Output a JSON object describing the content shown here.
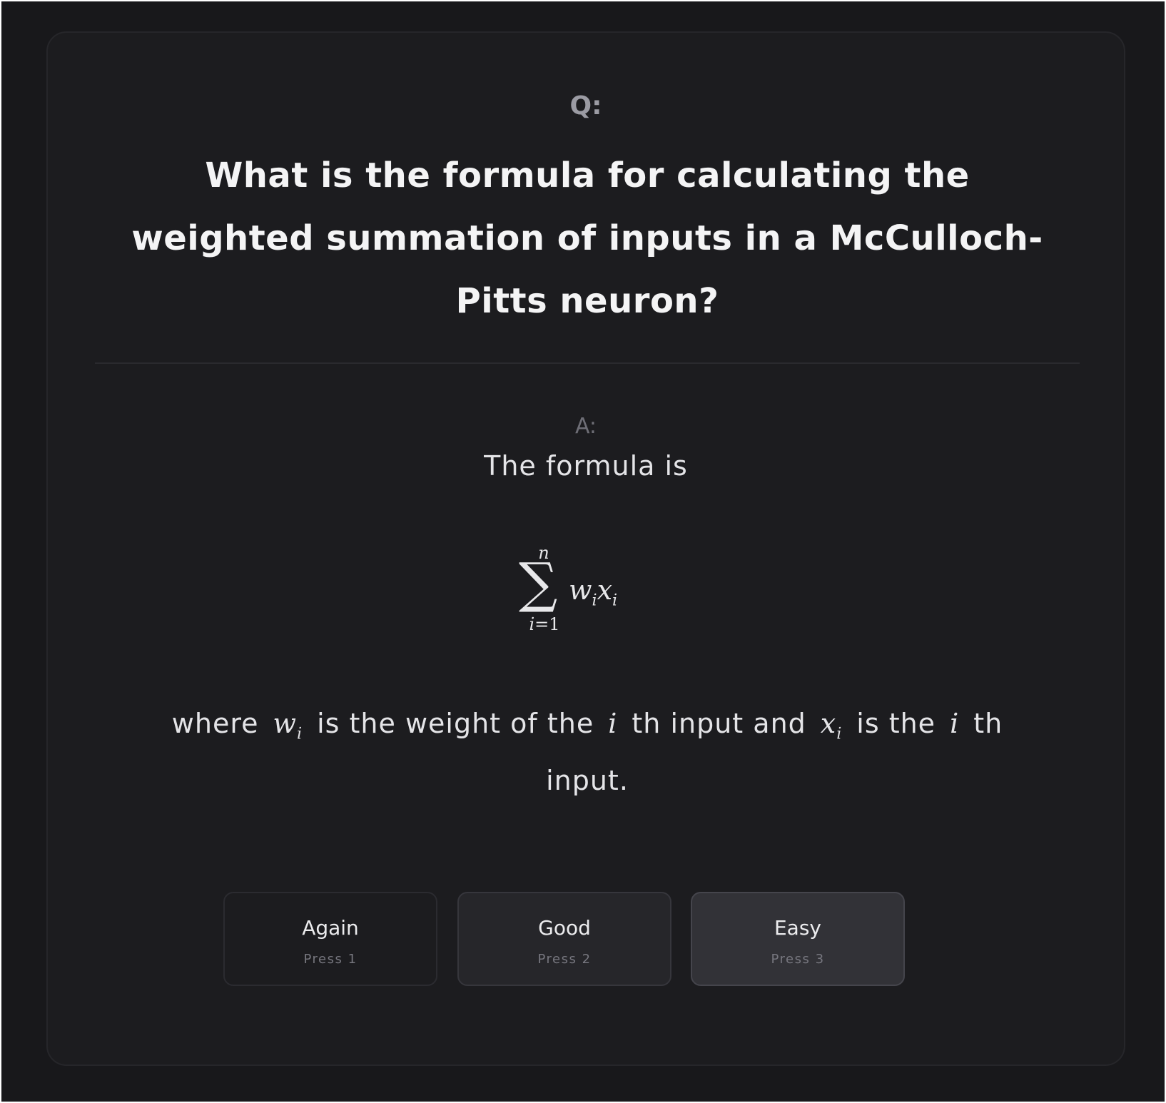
{
  "question": {
    "label": "Q:",
    "text": "What is the formula for calculating the weighted summation of inputs in a McCulloch-Pitts neuron?"
  },
  "answer": {
    "label": "A:",
    "intro": "The formula is",
    "formula": {
      "operator": "∑",
      "upper_limit": "n",
      "lower_limit_var": "i",
      "lower_limit_rest": "=1",
      "term1_var": "w",
      "term1_sub": "i",
      "term2_var": "x",
      "term2_sub": "i"
    },
    "explanation": {
      "part1": "where",
      "w_var": "w",
      "w_sub": "i",
      "part2": "is the weight of the",
      "i1": "i",
      "part3": "th input and",
      "x_var": "x",
      "x_sub": "i",
      "part4": "is the",
      "i2": "i",
      "part5": "th input."
    }
  },
  "buttons": [
    {
      "label": "Again",
      "hint": "Press 1"
    },
    {
      "label": "Good",
      "hint": "Press 2"
    },
    {
      "label": "Easy",
      "hint": "Press 3"
    }
  ],
  "colors": {
    "background": "#18181b",
    "card": "#1c1c1f",
    "text": "#f4f4f5",
    "muted": "#9b9ba3"
  }
}
